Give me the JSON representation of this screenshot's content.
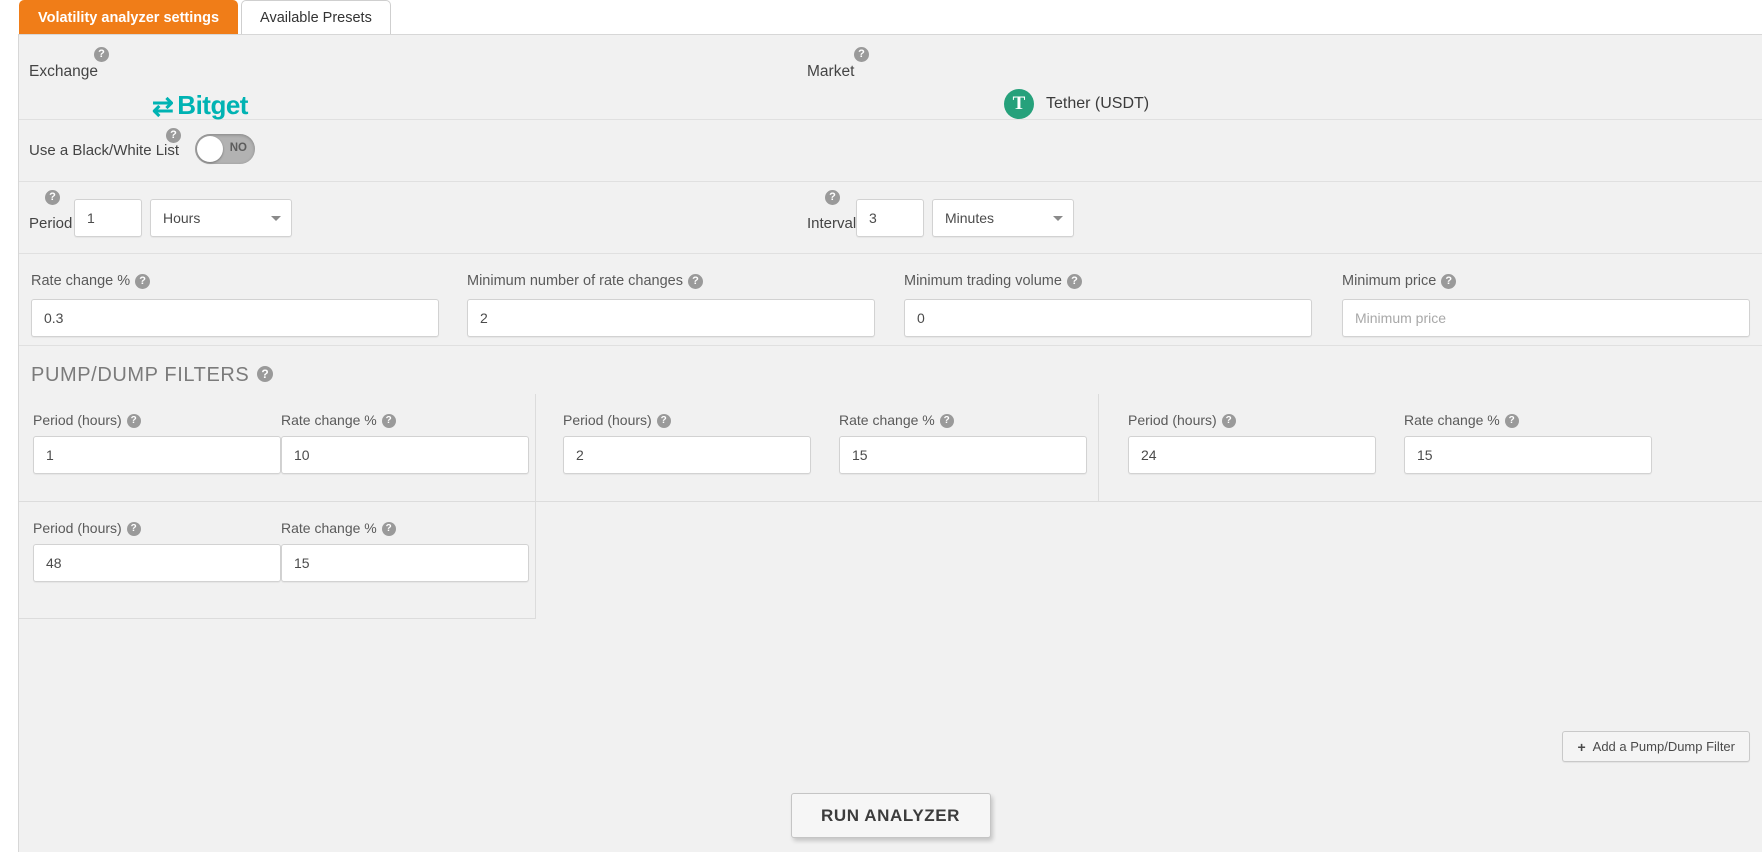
{
  "tabs": [
    {
      "label": "Volatility analyzer settings",
      "active": true
    },
    {
      "label": "Available Presets",
      "active": false
    }
  ],
  "top": {
    "exchange_label": "Exchange",
    "exchange_name": "Bitget",
    "market_label": "Market",
    "market_coin": "Tether (USDT)",
    "help_glyph": "?"
  },
  "blacklist": {
    "label": "Use a Black/White List",
    "toggle_value": "NO",
    "toggle_on": false
  },
  "period": {
    "label": "Period",
    "value": "1",
    "unit": "Hours"
  },
  "interval": {
    "label": "Interval",
    "value": "3",
    "unit": "Minutes"
  },
  "fields": [
    {
      "label": "Rate change %",
      "value": "0.3",
      "placeholder": ""
    },
    {
      "label": "Minimum number of rate changes",
      "value": "2",
      "placeholder": ""
    },
    {
      "label": "Minimum trading volume",
      "value": "0",
      "placeholder": ""
    },
    {
      "label": "Minimum price",
      "value": "",
      "placeholder": "Minimum price"
    }
  ],
  "pumpdump": {
    "title": "PUMP/DUMP FILTERS",
    "period_label": "Period (hours)",
    "rate_label": "Rate change %",
    "filters": [
      {
        "period": "1",
        "rate": "10"
      },
      {
        "period": "2",
        "rate": "15"
      },
      {
        "period": "24",
        "rate": "15"
      },
      {
        "period": "48",
        "rate": "15"
      }
    ]
  },
  "buttons": {
    "add_filter": "Add a Pump/Dump Filter",
    "add_filter_icon": "+",
    "run_analyzer": "RUN ANALYZER"
  },
  "colors": {
    "tab_active": "#f07d18",
    "brand_bitget": "#00b3b3",
    "coin_tether": "#26a17b",
    "panel_bg": "#f1f1f1"
  }
}
